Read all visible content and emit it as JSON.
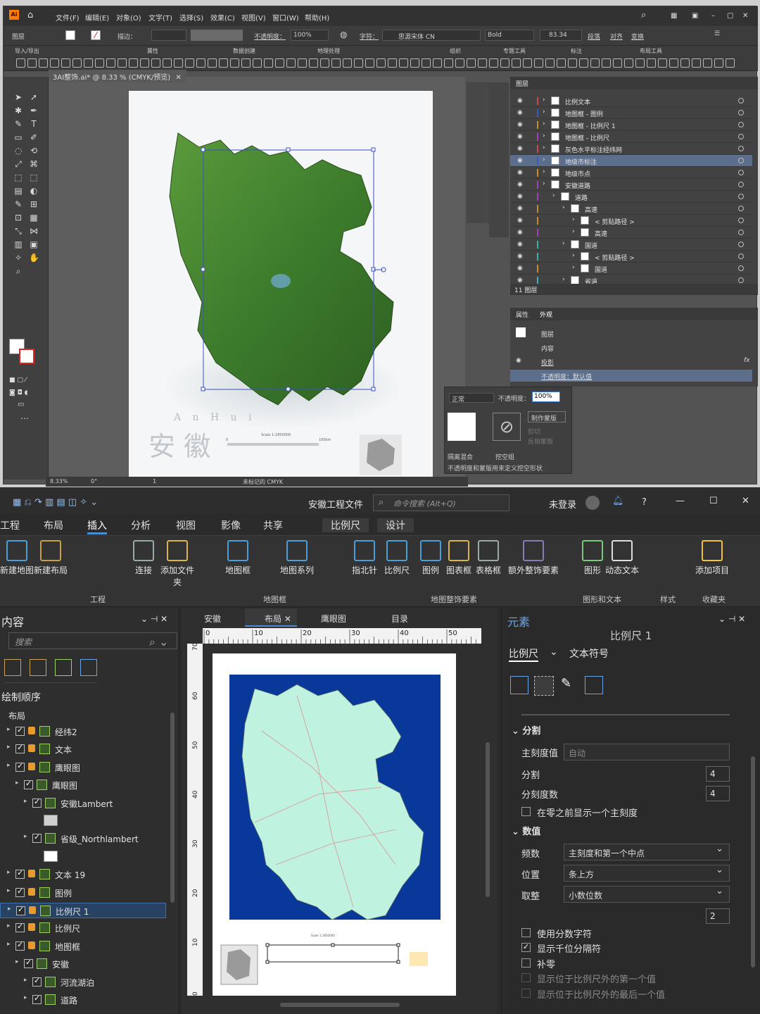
{
  "illustrator": {
    "menu": [
      "文件(F)",
      "编辑(E)",
      "对象(O)",
      "文字(T)",
      "选择(S)",
      "效果(C)",
      "视图(V)",
      "窗口(W)",
      "帮助(H)"
    ],
    "control": {
      "layer_label": "图层",
      "stroke_label": "描边：",
      "opacity_label": "不透明度：",
      "opacity_value": "100%",
      "font_label": "字符：",
      "font_name": "思源宋体 CN",
      "font_style": "Bold",
      "size_value": "83.34",
      "para": "段落",
      "align": "对齐",
      "transform": "变换"
    },
    "toolbar_groups": [
      "导入/导出",
      "属性",
      "数据创建",
      "地理处理",
      "组织",
      "专题工具",
      "标注",
      "布局工具"
    ],
    "doc_tab": "3AI整饰.ai* @ 8.33 % (CMYK/预览)",
    "map": {
      "title_cn": "安 徽",
      "title_en": "A n H u i",
      "scale": "Scale 1:1850000",
      "scale_unit": "100km",
      "scale_zero": "0"
    },
    "status": {
      "zoom": "8.33%",
      "angle": "0°",
      "page": "1",
      "profile": "未标记的 CMYK"
    },
    "layers_panel": {
      "title": "图层",
      "rows": [
        {
          "name": "比例文本",
          "color": "#c84b4b",
          "indent": 0
        },
        {
          "name": "地图框 - 图例",
          "color": "#3f58c6",
          "indent": 0
        },
        {
          "name": "地图框 - 比例尺 1",
          "color": "#c88b2a",
          "indent": 0
        },
        {
          "name": "地图框 - 比例尺",
          "color": "#a23fbf",
          "indent": 0
        },
        {
          "name": "灰色水平标注经纬网",
          "color": "#c84b4b",
          "indent": 0
        },
        {
          "name": "地级市标注",
          "color": "#3f58c6",
          "indent": 0
        },
        {
          "name": "地级市点",
          "color": "#c88b2a",
          "indent": 0
        },
        {
          "name": "安徽道路",
          "color": "#a23fbf",
          "indent": 0
        },
        {
          "name": "道路",
          "color": "#a23fbf",
          "indent": 1
        },
        {
          "name": "高速",
          "color": "#c88b2a",
          "indent": 2
        },
        {
          "name": "< 剪贴路径 >",
          "color": "#c88b2a",
          "indent": 3
        },
        {
          "name": "高速",
          "color": "#a23fbf",
          "indent": 3
        },
        {
          "name": "国道",
          "color": "#3fb1b1",
          "indent": 2
        },
        {
          "name": "< 剪贴路径 >",
          "color": "#3fb1b1",
          "indent": 3
        },
        {
          "name": "国道",
          "color": "#c88b2a",
          "indent": 3
        },
        {
          "name": "省道",
          "color": "#3fb1b1",
          "indent": 2
        }
      ],
      "footer": "11 图层"
    },
    "appearance": {
      "tabs": [
        "属性",
        "外观"
      ],
      "layer": "图层",
      "content": "内容",
      "shadow": "投影",
      "opacity": "不透明度：默认值",
      "fx": "fx"
    },
    "transparency": {
      "mode": "正常",
      "label": "不透明度：",
      "value": "100%",
      "make_mask": "制作蒙版",
      "clip": "剪切",
      "invert": "反相蒙版",
      "isolate": "隔离混合",
      "knockout": "挖空组",
      "opacity_mask": "不透明度和蒙版用来定义挖空形状"
    }
  },
  "arcgis": {
    "project_title": "安徽工程文件",
    "search_placeholder": "命令搜索 (Alt+Q)",
    "login": "未登录",
    "tabs": [
      "工程",
      "布局",
      "插入",
      "分析",
      "视图",
      "影像",
      "共享",
      "比例尺",
      "设计"
    ],
    "active_tab": "插入",
    "ribbon": [
      {
        "label": "新建地图"
      },
      {
        "label": "新建布局"
      },
      {
        "label": "连接"
      },
      {
        "label": "添加文件夹"
      },
      {
        "label": "地图框"
      },
      {
        "label": "地图系列"
      },
      {
        "label": "指北针"
      },
      {
        "label": "比例尺"
      },
      {
        "label": "图例"
      },
      {
        "label": "图表框"
      },
      {
        "label": "表格框"
      },
      {
        "label": "额外整饰要素"
      },
      {
        "label": "图形"
      },
      {
        "label": "动态文本"
      },
      {
        "label": "添加项目"
      }
    ],
    "ribbon_groups": [
      "工程",
      "地图框",
      "地图整饰要素",
      "图形和文本",
      "样式",
      "收藏夹"
    ],
    "contents": {
      "title": "内容",
      "search_placeholder": "搜索",
      "section": "绘制顺序",
      "root": "布局",
      "items": [
        {
          "name": "经纬2",
          "level": 1,
          "checked": true,
          "lock": true,
          "sel": false
        },
        {
          "name": "文本",
          "level": 1,
          "checked": true,
          "lock": true,
          "sel": false
        },
        {
          "name": "鹰眼图",
          "level": 1,
          "checked": true,
          "lock": true,
          "sel": false
        },
        {
          "name": "鹰眼图",
          "level": 2,
          "checked": true,
          "lock": false,
          "sel": false
        },
        {
          "name": "安徽Lambert",
          "level": 3,
          "checked": true,
          "lock": false,
          "sel": false
        },
        {
          "name": "",
          "level": 4,
          "checked": false,
          "lock": false,
          "sel": false
        },
        {
          "name": "省级_Northlambert",
          "level": 3,
          "checked": true,
          "lock": false,
          "sel": false
        },
        {
          "name": "",
          "level": 4,
          "checked": false,
          "lock": false,
          "sel": false
        },
        {
          "name": "文本 19",
          "level": 1,
          "checked": true,
          "lock": true,
          "sel": false
        },
        {
          "name": "图例",
          "level": 1,
          "checked": true,
          "lock": true,
          "sel": false
        },
        {
          "name": "比例尺 1",
          "level": 1,
          "checked": true,
          "lock": true,
          "sel": true
        },
        {
          "name": "比例尺",
          "level": 1,
          "checked": true,
          "lock": true,
          "sel": false
        },
        {
          "name": "地图框",
          "level": 1,
          "checked": true,
          "lock": true,
          "sel": false
        },
        {
          "name": "安徽",
          "level": 2,
          "checked": true,
          "lock": false,
          "sel": false
        },
        {
          "name": "河流湖泊",
          "level": 3,
          "checked": true,
          "lock": false,
          "sel": false
        },
        {
          "name": "道路",
          "level": 3,
          "checked": true,
          "lock": false,
          "sel": false
        }
      ]
    },
    "view_tabs": [
      "安徽",
      "布局",
      "鹰眼图",
      "目录"
    ],
    "ruler_ticks": [
      "0",
      "10",
      "20",
      "30",
      "40",
      "50"
    ],
    "ruler_v_ticks": [
      "70",
      "60",
      "50",
      "40",
      "30",
      "20",
      "10",
      "0"
    ],
    "layout_scale_text": "Scale 1:1850000",
    "element_panel": {
      "title": "元素",
      "subtitle": "比例尺 1",
      "tabs": [
        "比例尺",
        "文本符号"
      ],
      "division_section": "分割",
      "major_label": "主刻度值",
      "major_value": "自动",
      "divisions_label": "分割",
      "divisions_value": "4",
      "subdiv_label": "分刻度数",
      "subdiv_value": "4",
      "before_zero": "在零之前显示一个主刻度",
      "numbers_section": "数值",
      "freq_label": "频数",
      "freq_value": "主刻度和第一个中点",
      "pos_label": "位置",
      "pos_value": "条上方",
      "round_label": "取整",
      "round_value": "小数位数",
      "decimals": "2",
      "fraction": "使用分数字符",
      "thousands": "显示千位分隔符",
      "pad": "补零",
      "first_out": "显示位于比例尺外的第一个值",
      "last_out": "显示位于比例尺外的最后一个值"
    }
  }
}
